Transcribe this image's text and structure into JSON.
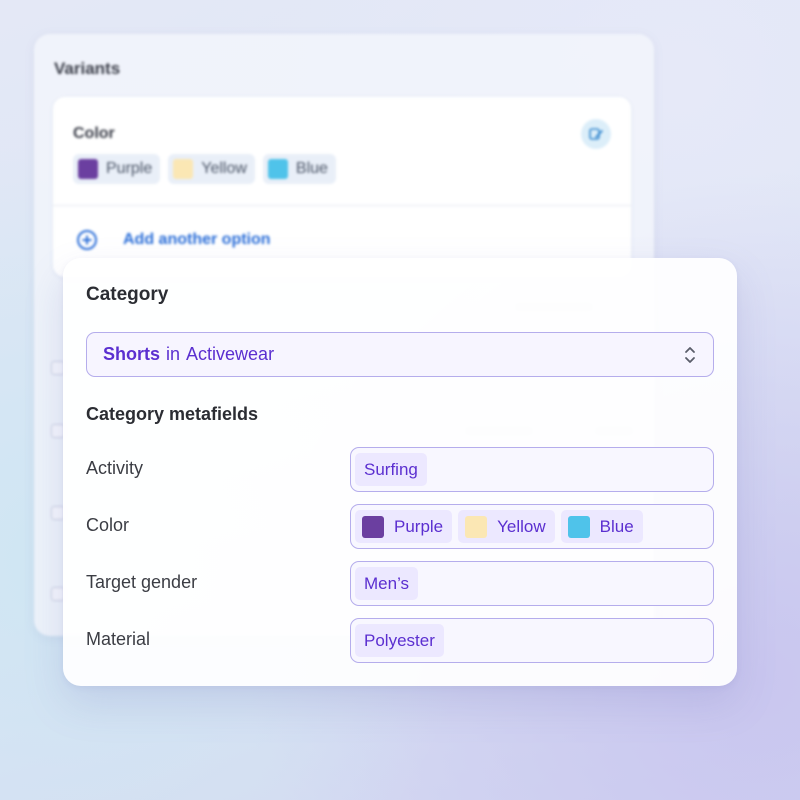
{
  "variants": {
    "title": "Variants",
    "option_name": "Color",
    "values": [
      {
        "label": "Purple",
        "color": "#6b3fa0"
      },
      {
        "label": "Yellow",
        "color": "#fbe7b4"
      },
      {
        "label": "Blue",
        "color": "#4fc3ea"
      }
    ],
    "add_option_label": "Add another option"
  },
  "category": {
    "title": "Category",
    "selected": {
      "name": "Shorts",
      "connector": "in",
      "parent": "Activewear"
    },
    "metafields_title": "Category metafields",
    "metafields": [
      {
        "label": "Activity",
        "values": [
          {
            "label": "Surfing"
          }
        ]
      },
      {
        "label": "Color",
        "values": [
          {
            "label": "Purple",
            "color": "#6b3fa0"
          },
          {
            "label": "Yellow",
            "color": "#fbe7b4"
          },
          {
            "label": "Blue",
            "color": "#4fc3ea"
          }
        ]
      },
      {
        "label": "Target gender",
        "values": [
          {
            "label": "Men’s"
          }
        ]
      },
      {
        "label": "Material",
        "values": [
          {
            "label": "Polyester"
          }
        ]
      }
    ]
  },
  "colors": {
    "accent": "#5b2fd0",
    "link": "#2c6fd8",
    "field_border": "#b5adec"
  }
}
